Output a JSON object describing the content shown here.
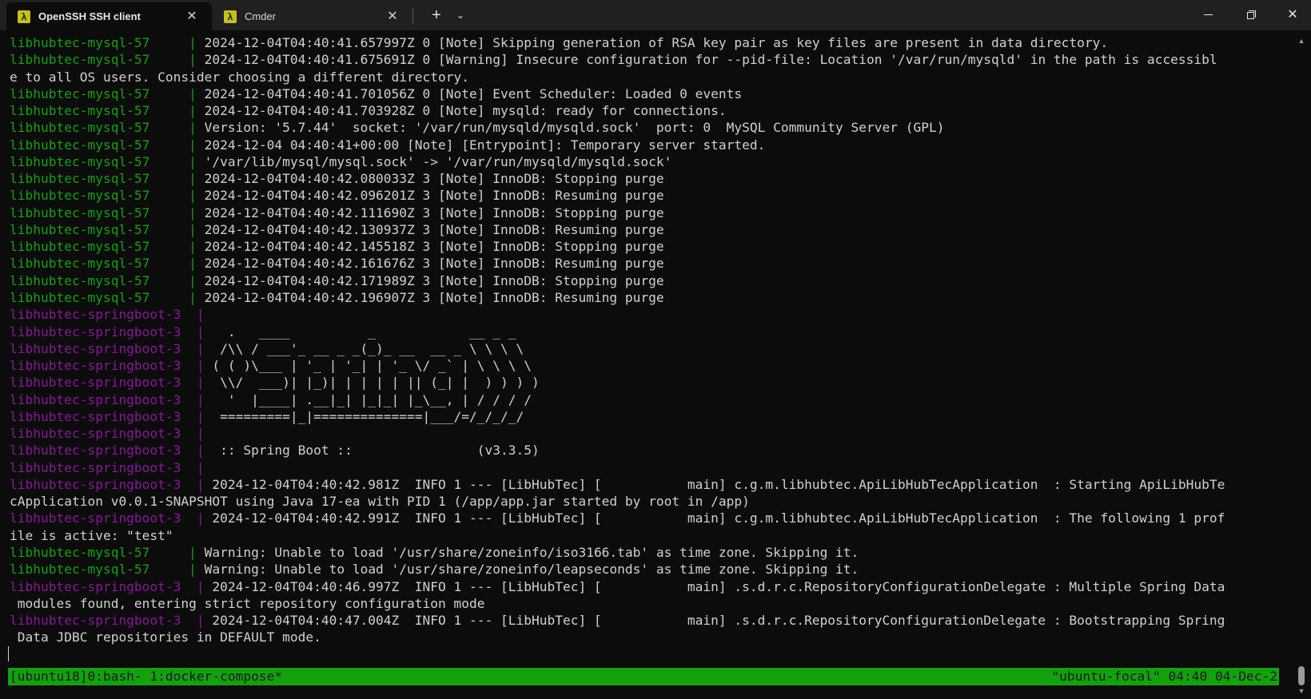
{
  "tabs": [
    {
      "label": "OpenSSH SSH client",
      "icon": "lambda-icon",
      "glyph": "λ",
      "active": true
    },
    {
      "label": "Cmder",
      "icon": "lambda-icon",
      "glyph": "λ",
      "active": false
    }
  ],
  "tabbar": {
    "close_glyph": "✕",
    "new_tab_glyph": "+",
    "dropdown_glyph": "⌄"
  },
  "window": {
    "close_glyph": "✕"
  },
  "colors": {
    "background": "#0c0c0c",
    "mysql_prefix": "#13a10e",
    "springboot_prefix": "#881798",
    "statusbar": "#13a10e"
  },
  "terminal": {
    "lines": [
      {
        "svc": "mysql",
        "prefix": "libhubtec-mysql-57     | ",
        "text": "2024-12-04T04:40:41.657997Z 0 [Note] Skipping generation of RSA key pair as key files are present in data directory."
      },
      {
        "svc": "mysql",
        "prefix": "libhubtec-mysql-57     | ",
        "text": "2024-12-04T04:40:41.675691Z 0 [Warning] Insecure configuration for --pid-file: Location '/var/run/mysqld' in the path is accessibl"
      },
      {
        "svc": "",
        "prefix": "",
        "text": "e to all OS users. Consider choosing a different directory."
      },
      {
        "svc": "mysql",
        "prefix": "libhubtec-mysql-57     | ",
        "text": "2024-12-04T04:40:41.701056Z 0 [Note] Event Scheduler: Loaded 0 events"
      },
      {
        "svc": "mysql",
        "prefix": "libhubtec-mysql-57     | ",
        "text": "2024-12-04T04:40:41.703928Z 0 [Note] mysqld: ready for connections."
      },
      {
        "svc": "mysql",
        "prefix": "libhubtec-mysql-57     | ",
        "text": "Version: '5.7.44'  socket: '/var/run/mysqld/mysqld.sock'  port: 0  MySQL Community Server (GPL)"
      },
      {
        "svc": "mysql",
        "prefix": "libhubtec-mysql-57     | ",
        "text": "2024-12-04 04:40:41+00:00 [Note] [Entrypoint]: Temporary server started."
      },
      {
        "svc": "mysql",
        "prefix": "libhubtec-mysql-57     | ",
        "text": "'/var/lib/mysql/mysql.sock' -> '/var/run/mysqld/mysqld.sock'"
      },
      {
        "svc": "mysql",
        "prefix": "libhubtec-mysql-57     | ",
        "text": "2024-12-04T04:40:42.080033Z 3 [Note] InnoDB: Stopping purge"
      },
      {
        "svc": "mysql",
        "prefix": "libhubtec-mysql-57     | ",
        "text": "2024-12-04T04:40:42.096201Z 3 [Note] InnoDB: Resuming purge"
      },
      {
        "svc": "mysql",
        "prefix": "libhubtec-mysql-57     | ",
        "text": "2024-12-04T04:40:42.111690Z 3 [Note] InnoDB: Stopping purge"
      },
      {
        "svc": "mysql",
        "prefix": "libhubtec-mysql-57     | ",
        "text": "2024-12-04T04:40:42.130937Z 3 [Note] InnoDB: Resuming purge"
      },
      {
        "svc": "mysql",
        "prefix": "libhubtec-mysql-57     | ",
        "text": "2024-12-04T04:40:42.145518Z 3 [Note] InnoDB: Stopping purge"
      },
      {
        "svc": "mysql",
        "prefix": "libhubtec-mysql-57     | ",
        "text": "2024-12-04T04:40:42.161676Z 3 [Note] InnoDB: Resuming purge"
      },
      {
        "svc": "mysql",
        "prefix": "libhubtec-mysql-57     | ",
        "text": "2024-12-04T04:40:42.171989Z 3 [Note] InnoDB: Stopping purge"
      },
      {
        "svc": "mysql",
        "prefix": "libhubtec-mysql-57     | ",
        "text": "2024-12-04T04:40:42.196907Z 3 [Note] InnoDB: Resuming purge"
      },
      {
        "svc": "spring",
        "prefix": "libhubtec-springboot-3  | ",
        "text": ""
      },
      {
        "svc": "spring",
        "prefix": "libhubtec-springboot-3  | ",
        "text": "  .   ____          _            __ _ _"
      },
      {
        "svc": "spring",
        "prefix": "libhubtec-springboot-3  | ",
        "text": " /\\\\ / ___'_ __ _ _(_)_ __  __ _ \\ \\ \\ \\"
      },
      {
        "svc": "spring",
        "prefix": "libhubtec-springboot-3  | ",
        "text": "( ( )\\___ | '_ | '_| | '_ \\/ _` | \\ \\ \\ \\"
      },
      {
        "svc": "spring",
        "prefix": "libhubtec-springboot-3  | ",
        "text": " \\\\/  ___)| |_)| | | | | || (_| |  ) ) ) )"
      },
      {
        "svc": "spring",
        "prefix": "libhubtec-springboot-3  | ",
        "text": "  '  |____| .__|_| |_|_| |_\\__, | / / / /"
      },
      {
        "svc": "spring",
        "prefix": "libhubtec-springboot-3  | ",
        "text": " =========|_|==============|___/=/_/_/_/"
      },
      {
        "svc": "spring",
        "prefix": "libhubtec-springboot-3  | ",
        "text": ""
      },
      {
        "svc": "spring",
        "prefix": "libhubtec-springboot-3  | ",
        "text": " :: Spring Boot ::                (v3.3.5)"
      },
      {
        "svc": "spring",
        "prefix": "libhubtec-springboot-3  | ",
        "text": ""
      },
      {
        "svc": "spring",
        "prefix": "libhubtec-springboot-3  | ",
        "text": "2024-12-04T04:40:42.981Z  INFO 1 --- [LibHubTec] [           main] c.g.m.libhubtec.ApiLibHubTecApplication  : Starting ApiLibHubTe"
      },
      {
        "svc": "",
        "prefix": "",
        "text": "cApplication v0.0.1-SNAPSHOT using Java 17-ea with PID 1 (/app/app.jar started by root in /app)"
      },
      {
        "svc": "spring",
        "prefix": "libhubtec-springboot-3  | ",
        "text": "2024-12-04T04:40:42.991Z  INFO 1 --- [LibHubTec] [           main] c.g.m.libhubtec.ApiLibHubTecApplication  : The following 1 prof"
      },
      {
        "svc": "",
        "prefix": "",
        "text": "ile is active: \"test\""
      },
      {
        "svc": "mysql",
        "prefix": "libhubtec-mysql-57     | ",
        "text": "Warning: Unable to load '/usr/share/zoneinfo/iso3166.tab' as time zone. Skipping it."
      },
      {
        "svc": "mysql",
        "prefix": "libhubtec-mysql-57     | ",
        "text": "Warning: Unable to load '/usr/share/zoneinfo/leapseconds' as time zone. Skipping it."
      },
      {
        "svc": "spring",
        "prefix": "libhubtec-springboot-3  | ",
        "text": "2024-12-04T04:40:46.997Z  INFO 1 --- [LibHubTec] [           main] .s.d.r.c.RepositoryConfigurationDelegate : Multiple Spring Data"
      },
      {
        "svc": "",
        "prefix": "",
        "text": " modules found, entering strict repository configuration mode"
      },
      {
        "svc": "spring",
        "prefix": "libhubtec-springboot-3  | ",
        "text": "2024-12-04T04:40:47.004Z  INFO 1 --- [LibHubTec] [           main] .s.d.r.c.RepositoryConfigurationDelegate : Bootstrapping Spring"
      },
      {
        "svc": "",
        "prefix": "",
        "text": " Data JDBC repositories in DEFAULT mode."
      }
    ]
  },
  "statusbar": {
    "left": "[ubuntu18]0:bash- 1:docker-compose*",
    "right": "\"ubuntu-focal\" 04:40 04-Dec-2"
  }
}
